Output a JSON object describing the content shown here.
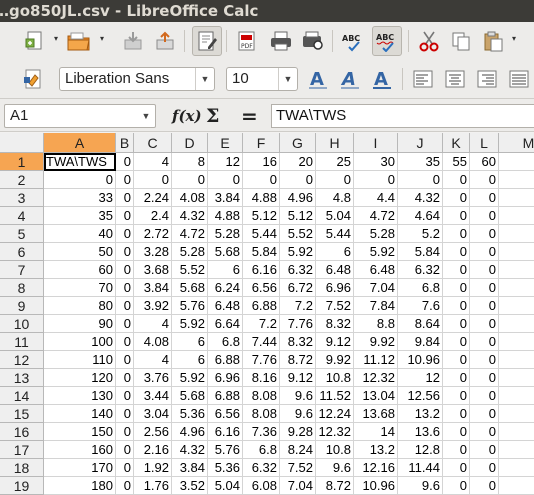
{
  "window": {
    "title": "…go850JL.csv - LibreOffice Calc"
  },
  "toolbar": {
    "icons": [
      "new-icon",
      "open-icon",
      "templates-icon",
      "save-icon",
      "edit-mode-icon",
      "export-pdf-icon",
      "print-icon",
      "print-preview-icon",
      "spelling-icon",
      "autospell-icon",
      "cut-icon",
      "copy-icon",
      "paste-icon"
    ],
    "font_name": "Liberation Sans",
    "font_size": "10",
    "format_icons": [
      "bold-icon",
      "italic-icon",
      "underline-icon",
      "align-left-icon",
      "align-center-icon",
      "align-right-icon"
    ],
    "accent": "#3465a4"
  },
  "formula_bar": {
    "name_box": "A1",
    "fx_label": "f(x)",
    "sum_label": "Σ",
    "equals_label": "=",
    "content": "TWA\\TWS"
  },
  "sheet": {
    "selected_color": "#f6a552",
    "columns": [
      "A",
      "B",
      "C",
      "D",
      "E",
      "F",
      "G",
      "H",
      "I",
      "J",
      "K",
      "L",
      "M"
    ],
    "rows": [
      [
        "TWA\\TWS",
        "0",
        "4",
        "8",
        "12",
        "16",
        "20",
        "25",
        "30",
        "35",
        "55",
        "60"
      ],
      [
        "0",
        "0",
        "0",
        "0",
        "0",
        "0",
        "0",
        "0",
        "0",
        "0",
        "0",
        "0"
      ],
      [
        "33",
        "0",
        "2.24",
        "4.08",
        "3.84",
        "4.88",
        "4.96",
        "4.8",
        "4.4",
        "4.32",
        "0",
        "0"
      ],
      [
        "35",
        "0",
        "2.4",
        "4.32",
        "4.88",
        "5.12",
        "5.12",
        "5.04",
        "4.72",
        "4.64",
        "0",
        "0"
      ],
      [
        "40",
        "0",
        "2.72",
        "4.72",
        "5.28",
        "5.44",
        "5.52",
        "5.44",
        "5.28",
        "5.2",
        "0",
        "0"
      ],
      [
        "50",
        "0",
        "3.28",
        "5.28",
        "5.68",
        "5.84",
        "5.92",
        "6",
        "5.92",
        "5.84",
        "0",
        "0"
      ],
      [
        "60",
        "0",
        "3.68",
        "5.52",
        "6",
        "6.16",
        "6.32",
        "6.48",
        "6.48",
        "6.32",
        "0",
        "0"
      ],
      [
        "70",
        "0",
        "3.84",
        "5.68",
        "6.24",
        "6.56",
        "6.72",
        "6.96",
        "7.04",
        "6.8",
        "0",
        "0"
      ],
      [
        "80",
        "0",
        "3.92",
        "5.76",
        "6.48",
        "6.88",
        "7.2",
        "7.52",
        "7.84",
        "7.6",
        "0",
        "0"
      ],
      [
        "90",
        "0",
        "4",
        "5.92",
        "6.64",
        "7.2",
        "7.76",
        "8.32",
        "8.8",
        "8.64",
        "0",
        "0"
      ],
      [
        "100",
        "0",
        "4.08",
        "6",
        "6.8",
        "7.44",
        "8.32",
        "9.12",
        "9.92",
        "9.84",
        "0",
        "0"
      ],
      [
        "110",
        "0",
        "4",
        "6",
        "6.88",
        "7.76",
        "8.72",
        "9.92",
        "11.12",
        "10.96",
        "0",
        "0"
      ],
      [
        "120",
        "0",
        "3.76",
        "5.92",
        "6.96",
        "8.16",
        "9.12",
        "10.8",
        "12.32",
        "12",
        "0",
        "0"
      ],
      [
        "130",
        "0",
        "3.44",
        "5.68",
        "6.88",
        "8.08",
        "9.6",
        "11.52",
        "13.04",
        "12.56",
        "0",
        "0"
      ],
      [
        "140",
        "0",
        "3.04",
        "5.36",
        "6.56",
        "8.08",
        "9.6",
        "12.24",
        "13.68",
        "13.2",
        "0",
        "0"
      ],
      [
        "150",
        "0",
        "2.56",
        "4.96",
        "6.16",
        "7.36",
        "9.28",
        "12.32",
        "14",
        "13.6",
        "0",
        "0"
      ],
      [
        "160",
        "0",
        "2.16",
        "4.32",
        "5.76",
        "6.8",
        "8.24",
        "10.8",
        "13.2",
        "12.8",
        "0",
        "0"
      ],
      [
        "170",
        "0",
        "1.92",
        "3.84",
        "5.36",
        "6.32",
        "7.52",
        "9.6",
        "12.16",
        "11.44",
        "0",
        "0"
      ],
      [
        "180",
        "0",
        "1.76",
        "3.52",
        "5.04",
        "6.08",
        "7.04",
        "8.72",
        "10.96",
        "9.6",
        "0",
        "0"
      ],
      [
        "",
        "",
        "",
        "",
        "",
        "",
        "",
        "",
        "",
        "",
        "",
        ""
      ]
    ]
  }
}
